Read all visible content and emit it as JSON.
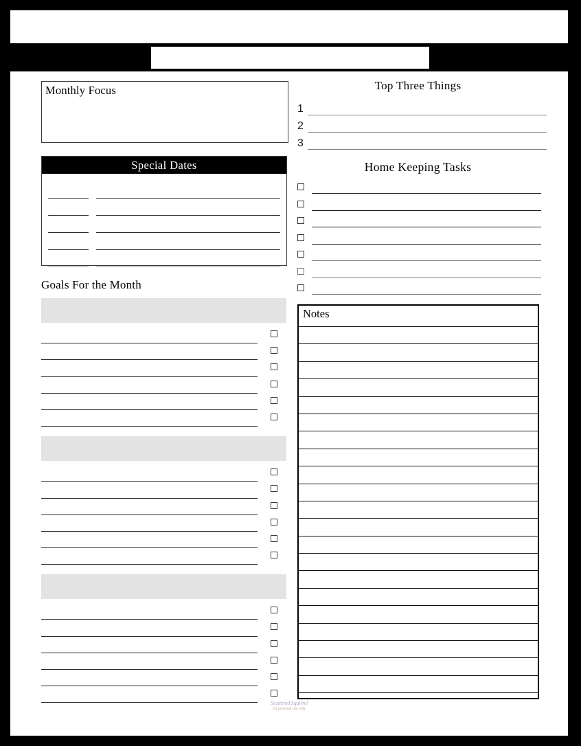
{
  "document": {
    "kind": "monthly-planner-printable",
    "title_field_value": "",
    "title_field_placeholder": ""
  },
  "monthly_focus": {
    "label": "Monthly Focus",
    "value": ""
  },
  "top_three": {
    "title": "Top Three Things",
    "rows": [
      {
        "number": "1",
        "value": ""
      },
      {
        "number": "2",
        "value": ""
      },
      {
        "number": "3",
        "value": ""
      }
    ]
  },
  "special_dates": {
    "title": "Special Dates",
    "rows": [
      {
        "date": "",
        "description": ""
      },
      {
        "date": "",
        "description": ""
      },
      {
        "date": "",
        "description": ""
      },
      {
        "date": "",
        "description": ""
      },
      {
        "date": "",
        "description": ""
      }
    ]
  },
  "home_keeping": {
    "title": "Home Keeping Tasks",
    "rows": [
      {
        "checked": false,
        "value": ""
      },
      {
        "checked": false,
        "value": ""
      },
      {
        "checked": false,
        "value": ""
      },
      {
        "checked": false,
        "value": ""
      },
      {
        "checked": false,
        "value": ""
      },
      {
        "checked": false,
        "value": ""
      },
      {
        "checked": false,
        "value": ""
      }
    ]
  },
  "goals": {
    "title": "Goals For the Month",
    "groups": [
      {
        "heading": "",
        "rows": [
          "",
          "",
          "",
          "",
          "",
          ""
        ]
      },
      {
        "heading": "",
        "rows": [
          "",
          "",
          "",
          "",
          "",
          ""
        ]
      },
      {
        "heading": "",
        "rows": [
          "",
          "",
          "",
          "",
          "",
          ""
        ]
      }
    ]
  },
  "notes": {
    "label": "Notes",
    "line_count": 22,
    "lines": [
      "",
      "",
      "",
      "",
      "",
      "",
      "",
      "",
      "",
      "",
      "",
      "",
      "",
      "",
      "",
      "",
      "",
      "",
      "",
      "",
      "",
      ""
    ]
  },
  "footer": {
    "watermark_main": "Scattered Squirrel",
    "watermark_sub": "for personal use only"
  },
  "colors": {
    "frame": "#000000",
    "paper": "#ffffff",
    "band_black": "#000000",
    "band_gray": "#e3e3e3",
    "rule_dark": "#262626",
    "rule_light": "#7d7d7d"
  }
}
